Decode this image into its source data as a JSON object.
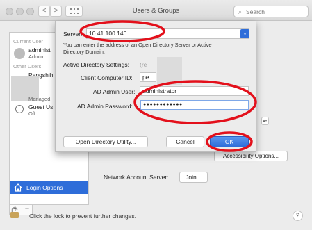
{
  "window": {
    "title": "Users & Groups",
    "search_placeholder": "Search",
    "nav_back": "<",
    "nav_forward": ">"
  },
  "sidebar": {
    "current_user_section": "Current User",
    "current_user": {
      "name": "administ",
      "role": "Admin"
    },
    "other_users_section": "Other Users",
    "other_users": [
      {
        "name": "Pengshih",
        "role": ""
      },
      {
        "name": "",
        "role": "Managed,"
      },
      {
        "name": "Guest Us",
        "role": "Off"
      }
    ],
    "login_options_label": "Login Options",
    "add_label": "+",
    "remove_label": "−"
  },
  "main": {
    "accessibility_button": "Accessibility Options...",
    "network_account_server_label": "Network Account Server:",
    "join_button": "Join..."
  },
  "footer": {
    "lock_text": "Click the lock to prevent further changes.",
    "help": "?"
  },
  "sheet": {
    "server_label": "Server:",
    "server_value": "10.41.100.140",
    "help_text": "You can enter the address of an Open Directory Server or Active Directory Domain.",
    "ad_settings_label": "Active Directory Settings:",
    "ad_settings_extra": "(re",
    "client_computer_id_label": "Client Computer ID:",
    "client_computer_id_value": "pe",
    "ad_admin_user_label": "AD Admin User:",
    "ad_admin_user_value": "administrator",
    "ad_admin_password_label": "AD Admin Password:",
    "ad_admin_password_value": "●●●●●●●●●●●●",
    "open_directory_button": "Open Directory Utility...",
    "cancel_button": "Cancel",
    "ok_button": "OK"
  },
  "colors": {
    "accent": "#2e6dd9",
    "annotation": "#e3101b"
  }
}
